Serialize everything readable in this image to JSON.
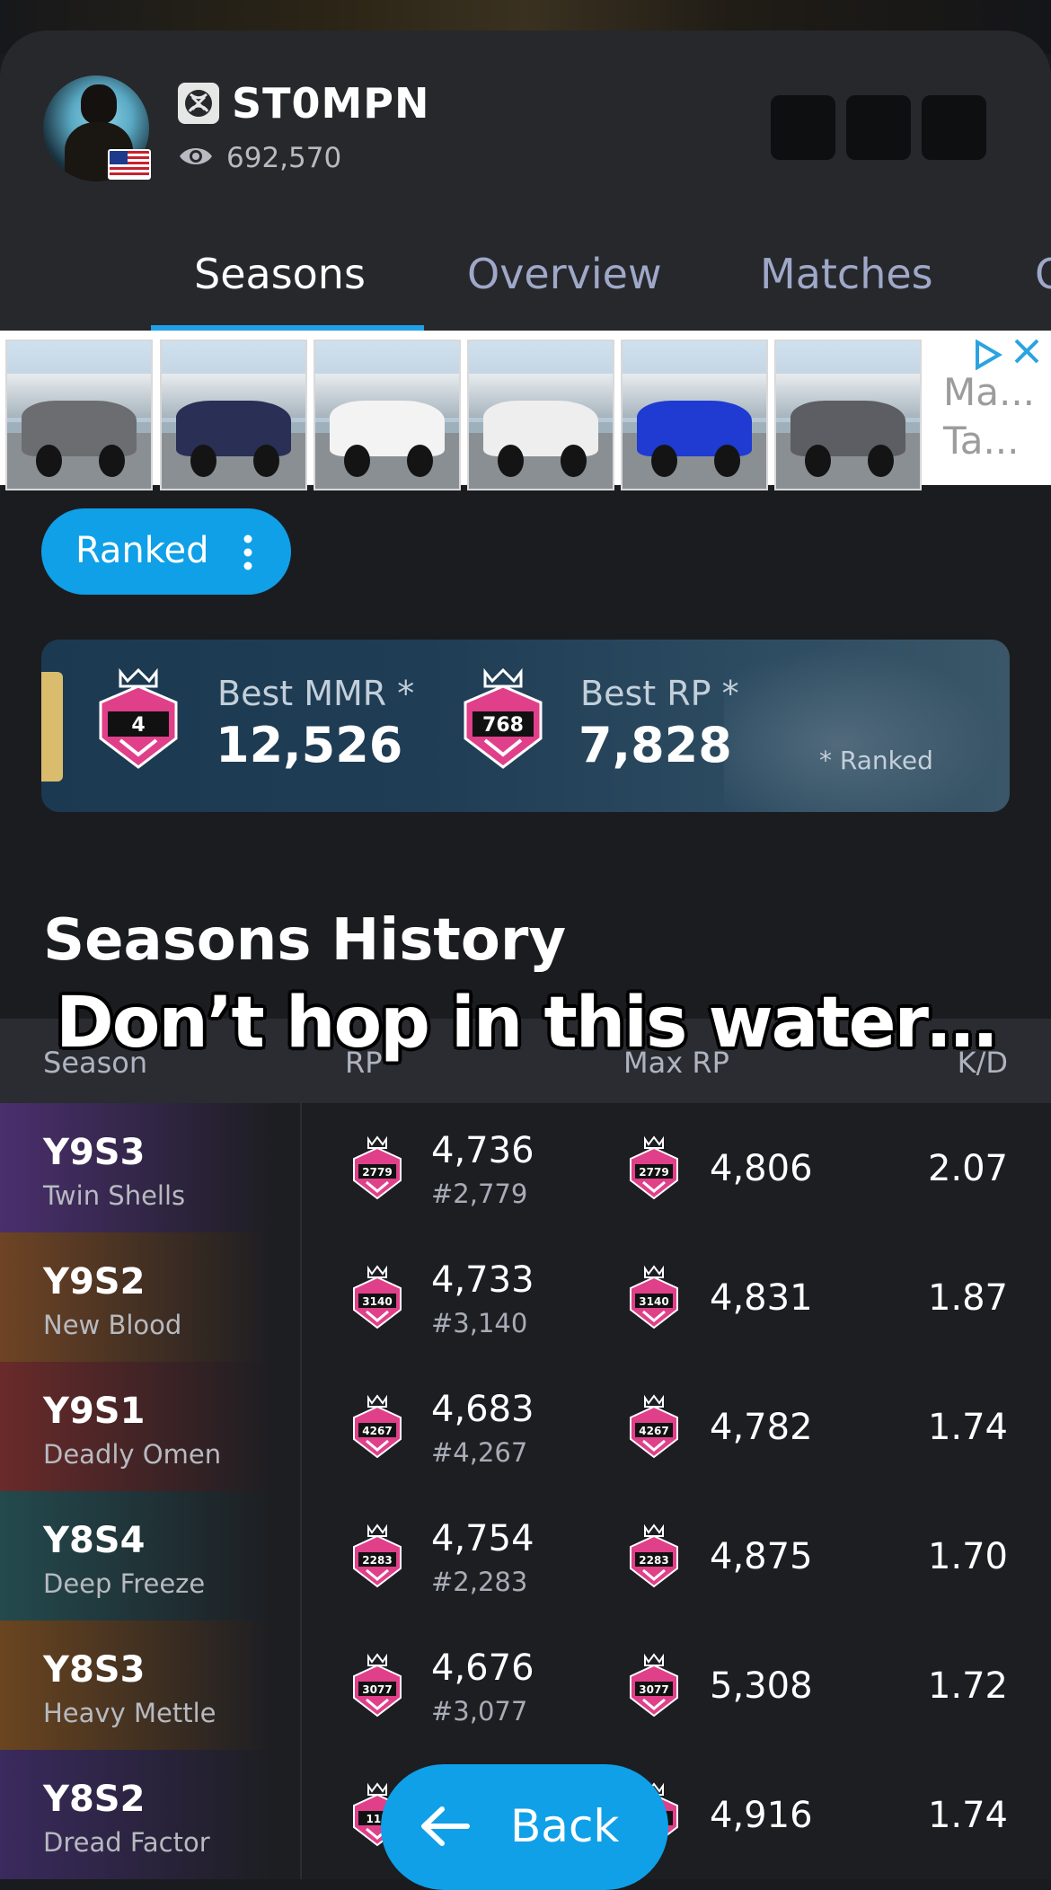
{
  "profile": {
    "username": "ST0MPN",
    "views": "692,570",
    "platform_icon": "xbox-icon",
    "flag_icon": "us-flag-icon"
  },
  "tabs": [
    "Seasons",
    "Overview",
    "Matches",
    "O"
  ],
  "ad": {
    "text_line1": "Ma...",
    "text_line2": "Ta...",
    "car_colors": [
      "#6b6d70",
      "#2a2f55",
      "#f3f3f3",
      "#eeeeee",
      "#1f3bd1",
      "#5c5e63"
    ]
  },
  "filter": {
    "label": "Ranked"
  },
  "best": {
    "mmr_label": "Best MMR *",
    "mmr_value": "12,526",
    "mmr_badge": "4",
    "rp_label": "Best RP *",
    "rp_value": "7,828",
    "rp_badge": "768",
    "note": "* Ranked"
  },
  "history": {
    "title": "Seasons History",
    "columns": [
      "Season",
      "RP",
      "Max RP",
      "K/D"
    ],
    "rows": [
      {
        "code": "Y9S3",
        "name": "Twin Shells",
        "rp": "4,736",
        "rank": "#2,779",
        "badge": "2779",
        "max_rp": "4,806",
        "kd": "2.07",
        "accent": "#4a2f6e"
      },
      {
        "code": "Y9S2",
        "name": "New Blood",
        "rp": "4,733",
        "rank": "#3,140",
        "badge": "3140",
        "max_rp": "4,831",
        "kd": "1.87",
        "accent": "#6e4424"
      },
      {
        "code": "Y9S1",
        "name": "Deadly Omen",
        "rp": "4,683",
        "rank": "#4,267",
        "badge": "4267",
        "max_rp": "4,782",
        "kd": "1.74",
        "accent": "#6a2a2a"
      },
      {
        "code": "Y8S4",
        "name": "Deep Freeze",
        "rp": "4,754",
        "rank": "#2,283",
        "badge": "2283",
        "max_rp": "4,875",
        "kd": "1.70",
        "accent": "#234a4e"
      },
      {
        "code": "Y8S3",
        "name": "Heavy Mettle",
        "rp": "4,676",
        "rank": "#3,077",
        "badge": "3077",
        "max_rp": "5,308",
        "kd": "1.72",
        "accent": "#6a4520"
      },
      {
        "code": "Y8S2",
        "name": "Dread Factor",
        "rp": "",
        "rank": "",
        "badge": "115",
        "max_rp": "4,916",
        "kd": "1.74",
        "accent": "#3a2a5e"
      }
    ]
  },
  "caption": "Don’t hop in this water…",
  "back": {
    "label": "Back"
  },
  "colors": {
    "accent_blue": "#0fa0e8",
    "badge_pink": "#e0408a",
    "gold_accent": "#d9bd6c"
  }
}
